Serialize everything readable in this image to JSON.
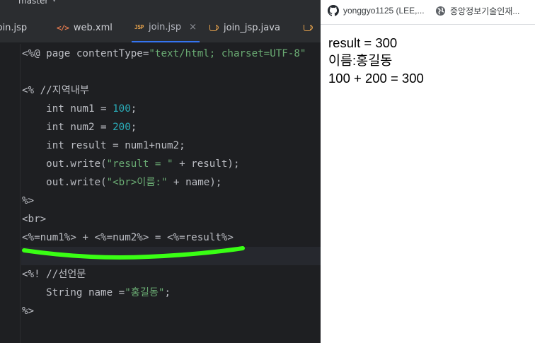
{
  "ide": {
    "branch": "master",
    "tabs": [
      {
        "label": "join.jsp",
        "icon": "jsp-file-icon",
        "active": false
      },
      {
        "label": "web.xml",
        "icon": "xml-file-icon",
        "active": false
      },
      {
        "label": "join.jsp",
        "icon": "jsp-file-icon",
        "active": true
      },
      {
        "label": "join_jsp.java",
        "icon": "java-class-icon",
        "active": false
      }
    ],
    "close_glyph": "×",
    "tab_jsp_icon_text": "JSP",
    "tab_xml_icon_text": "</>",
    "code": {
      "l1_a": "<%@ page contentType=",
      "l1_b": "\"text/html; charset=UTF-8\"",
      "l3_a": "<% ",
      "l3_b": "//지역내부",
      "l4_a": "    int num1 = ",
      "l4_b": "100",
      "l4_c": ";",
      "l5_a": "    int num2 = ",
      "l5_b": "200",
      "l5_c": ";",
      "l6": "    int result = num1+num2;",
      "l7_a": "    out.write(",
      "l7_b": "\"result = \"",
      "l7_c": " + result);",
      "l8_a": "    out.write(",
      "l8_b": "\"<br>이름:\"",
      "l8_c": " + name);",
      "l9": "%>",
      "l10": "<br>",
      "l11": "<%=num1%> + <%=num2%> = <%=result%>",
      "l13_a": "<%! ",
      "l13_b": "//선언문",
      "l14_a": "    String name =",
      "l14_b": "\"홍길동\"",
      "l14_c": ";",
      "l15": "%>"
    }
  },
  "browser": {
    "bookmarks": [
      {
        "label": "yonggyo1125 (LEE,...",
        "icon": "github-icon"
      },
      {
        "label": "중앙정보기술인재...",
        "icon": "globe-icon"
      }
    ],
    "output": {
      "line1": "result = 300",
      "line2": "이름:홍길동",
      "line3": "100 + 200 = 300"
    }
  },
  "colors": {
    "editor_bg": "#1e1f22",
    "string": "#6aab73",
    "number": "#2aacb8",
    "highlight_marker": "#39ff14",
    "active_tab_underline": "#3574f0"
  }
}
